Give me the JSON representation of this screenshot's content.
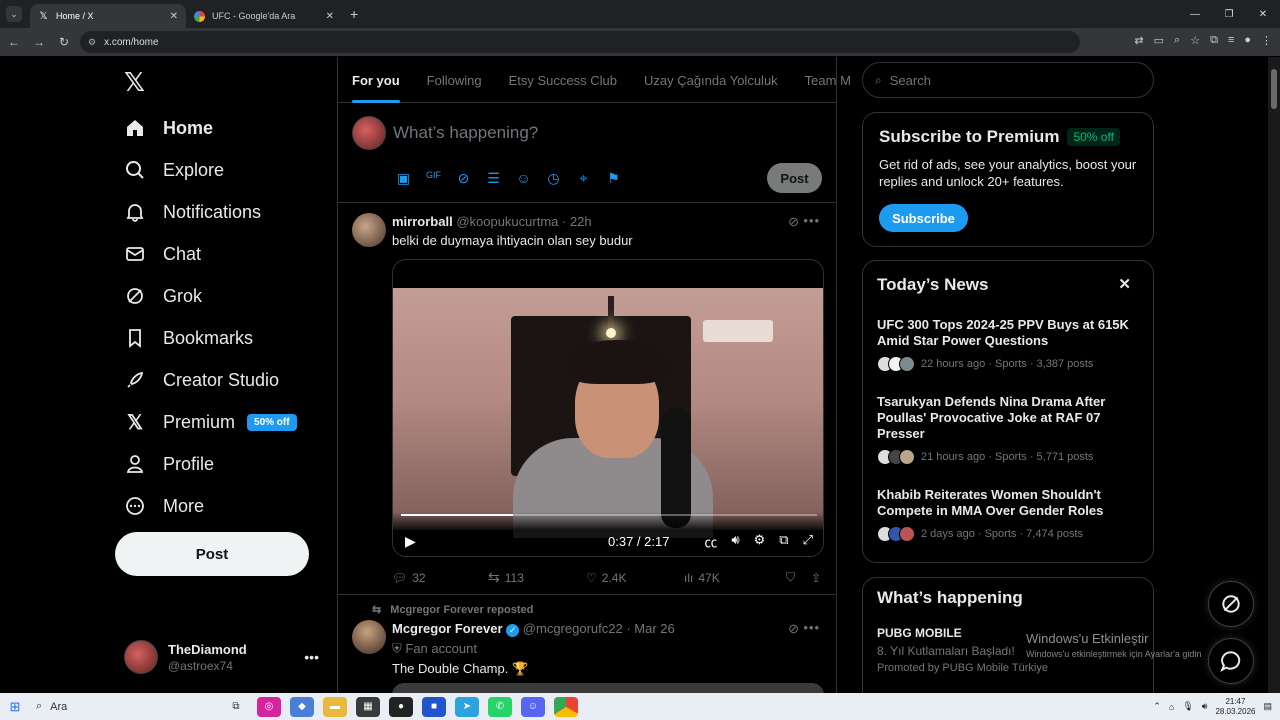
{
  "browser": {
    "tabs": [
      {
        "title": "Home / X",
        "active": true
      },
      {
        "title": "UFC - Google'da Ara",
        "active": false
      }
    ],
    "url": "x.com/home"
  },
  "nav": {
    "items": [
      {
        "label": "Home"
      },
      {
        "label": "Explore"
      },
      {
        "label": "Notifications"
      },
      {
        "label": "Chat"
      },
      {
        "label": "Grok"
      },
      {
        "label": "Bookmarks"
      },
      {
        "label": "Creator Studio"
      },
      {
        "label": "Premium",
        "badge": "50% off"
      },
      {
        "label": "Profile"
      },
      {
        "label": "More"
      }
    ],
    "post_label": "Post"
  },
  "account": {
    "name": "TheDiamond",
    "handle": "@astroex74"
  },
  "feed": {
    "tabs": [
      "For you",
      "Following",
      "Etsy Success Club",
      "Uzay Çağında Yolculuk",
      "Team M"
    ],
    "compose_placeholder": "What’s happening?",
    "compose_post": "Post",
    "tweets": [
      {
        "name": "mirrorball",
        "handle": "@koopukucurtma",
        "time": "· 22h",
        "text": "belki de duymaya ihtiyacin olan sey budur",
        "video_time": "0:37 / 2:17",
        "video_progress": 0.27,
        "replies": "32",
        "reposts": "113",
        "likes": "2.4K",
        "views": "47K"
      },
      {
        "reposted_by": "Mcgregor Forever reposted",
        "name": "Mcgregor Forever",
        "handle": "@mcgregorufc22",
        "time": "· Mar 26",
        "sub": "Fan account",
        "text": "The Double Champ. 🏆"
      }
    ]
  },
  "sidebar": {
    "search_placeholder": "Search",
    "premium": {
      "title": "Subscribe to Premium",
      "badge": "50% off",
      "desc": "Get rid of ads, see your analytics, boost your replies and unlock 20+ features.",
      "button": "Subscribe"
    },
    "news": {
      "title": "Today’s News",
      "items": [
        {
          "title": "UFC 300 Tops 2024-25 PPV Buys at 615K Amid Star Power Questions",
          "meta": "22 hours ago · Sports · 3,387 posts"
        },
        {
          "title": "Tsarukyan Defends Nina Drama After Poullas' Provocative Joke at RAF 07 Presser",
          "meta": "21 hours ago · Sports · 5,771 posts"
        },
        {
          "title": "Khabib Reiterates Women Shouldn't Compete in MMA Over Gender Roles",
          "meta": "2 days ago · Sports · 7,474 posts"
        }
      ]
    },
    "happening": {
      "title": "What’s happening",
      "topic": "PUBG MOBILE",
      "subtitle": "8. Yıl Kutlamaları Başladı!",
      "promoted": "Promoted by PUBG Mobile Türkiye"
    }
  },
  "overlay": {
    "activation_title": "Windows'u Etkinleştir",
    "activation_sub": "Windows'u etkinleştirmek için Ayarlar'a gidin"
  },
  "taskbar": {
    "search": "Ara",
    "time": "21:47",
    "date": "28.03.2026"
  }
}
